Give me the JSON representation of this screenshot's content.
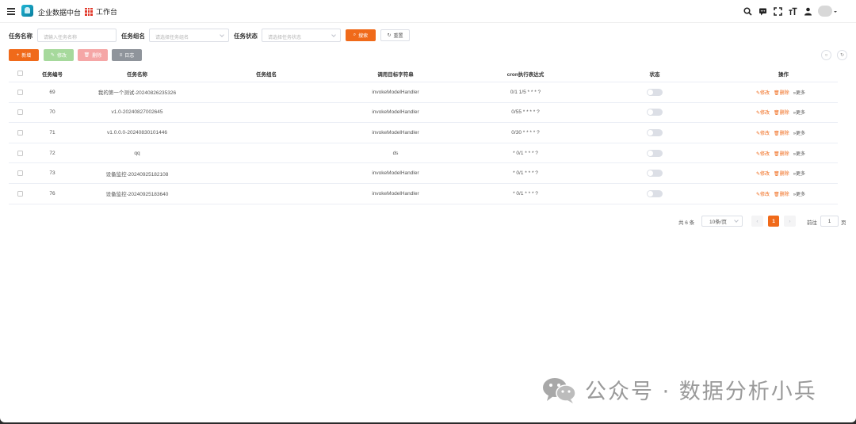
{
  "header": {
    "app_title": "企业数据中台",
    "workbench_label": "工作台",
    "icons": [
      "menu-icon",
      "app-logo",
      "grid-apps-icon",
      "search-icon",
      "message-icon",
      "fullscreen-icon",
      "font-size-icon",
      "user-icon"
    ],
    "brand_color": "#f06a1a"
  },
  "search": {
    "task_name_label": "任务名称",
    "task_name_placeholder": "请输入任务名称",
    "task_group_label": "任务组名",
    "task_group_placeholder": "请选择任务组名",
    "task_status_label": "任务状态",
    "task_status_placeholder": "请选择任务状态",
    "search_button": "搜索",
    "reset_button": "重置"
  },
  "toolbar": {
    "add_button": "新增",
    "edit_button": "修改",
    "delete_button": "删除",
    "log_button": "日志"
  },
  "table": {
    "columns": [
      "任务编号",
      "任务名称",
      "任务组名",
      "调用目标字符串",
      "cron执行表达式",
      "状态",
      "操作"
    ],
    "rows": [
      {
        "id": "69",
        "name": "我的第一个测试-20240826235326",
        "group": "",
        "target": "invokeModelHandler",
        "cron": "0/1 1/5 * * * ?"
      },
      {
        "id": "70",
        "name": "v1.0-20240827002645",
        "group": "",
        "target": "invokeModelHandler",
        "cron": "0/55 * * * * ?"
      },
      {
        "id": "71",
        "name": "v1.0.0.0-20240830101446",
        "group": "",
        "target": "invokeModelHandler",
        "cron": "0/30 * * * * ?"
      },
      {
        "id": "72",
        "name": "qq",
        "group": "",
        "target": "ds",
        "cron": "* 0/1 * * * ?"
      },
      {
        "id": "73",
        "name": "设备监控-20240925182108",
        "group": "",
        "target": "invokeModelHandler",
        "cron": "* 0/1 * * * ?"
      },
      {
        "id": "76",
        "name": "设备监控-20240925183640",
        "group": "",
        "target": "invokeModelHandler",
        "cron": "* 0/1 * * * ?"
      }
    ],
    "op_edit": "修改",
    "op_delete": "删除",
    "op_more": "更多"
  },
  "pagination": {
    "total": "共 6 条",
    "page_size": "10条/页",
    "current_page": "1",
    "goto_prefix": "前往",
    "goto_value": "1",
    "goto_suffix": "页"
  },
  "watermark": {
    "text": "公众号 · 数据分析小兵"
  }
}
